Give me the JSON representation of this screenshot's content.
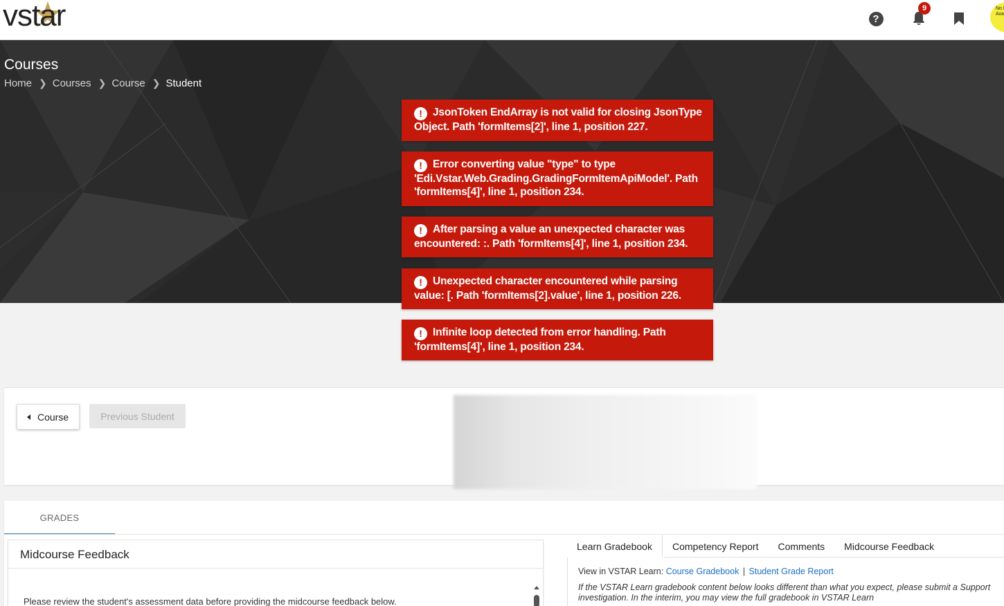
{
  "app": {
    "logo_text": "vstar"
  },
  "topbar": {
    "notification_count": "9",
    "avatar_text": "No Image Available"
  },
  "header": {
    "title": "Courses",
    "breadcrumb": [
      "Home",
      "Courses",
      "Course",
      "Student"
    ]
  },
  "errors": [
    "JsonToken EndArray is not valid for closing JsonType Object. Path 'formItems[2]', line 1, position 227.",
    "Error converting value \"type\" to type 'Edi.Vstar.Web.Grading.GradingFormItemApiModel'. Path 'formItems[4]', line 1, position 234.",
    "After parsing a value an unexpected character was encountered: :. Path 'formItems[4]', line 1, position 234.",
    "Unexpected character encountered while parsing value: [. Path 'formItems[2].value', line 1, position 226.",
    "Infinite loop detected from error handling. Path 'formItems[4]', line 1, position 234."
  ],
  "nav": {
    "course_button": "Course",
    "previous_student_button": "Previous Student"
  },
  "grades": {
    "tab_label": "GRADES",
    "left_card": {
      "title": "Midcourse Feedback",
      "body": "Please review the student's assessment data before providing the midcourse feedback below."
    },
    "right_tabs": [
      "Learn Gradebook",
      "Competency Report",
      "Comments",
      "Midcourse Feedback"
    ],
    "view_prefix": "View in VSTAR Learn:",
    "links": [
      "Course Gradebook",
      "Student Grade Report"
    ],
    "link_separator": "|",
    "note_line1": "If the VSTAR Learn gradebook content below looks different than what you expect, please submit a Support",
    "note_line2": "investigation. In the interim, you may view the full gradebook in VSTAR Learn"
  },
  "colors": {
    "error_bg": "#c4190b",
    "badge_bg": "#c4170a",
    "link": "#1e6fc0",
    "tab_underline": "#3d7bbd",
    "avatar_bg": "#f6ec3c",
    "logo_star": "#c8a35a"
  }
}
